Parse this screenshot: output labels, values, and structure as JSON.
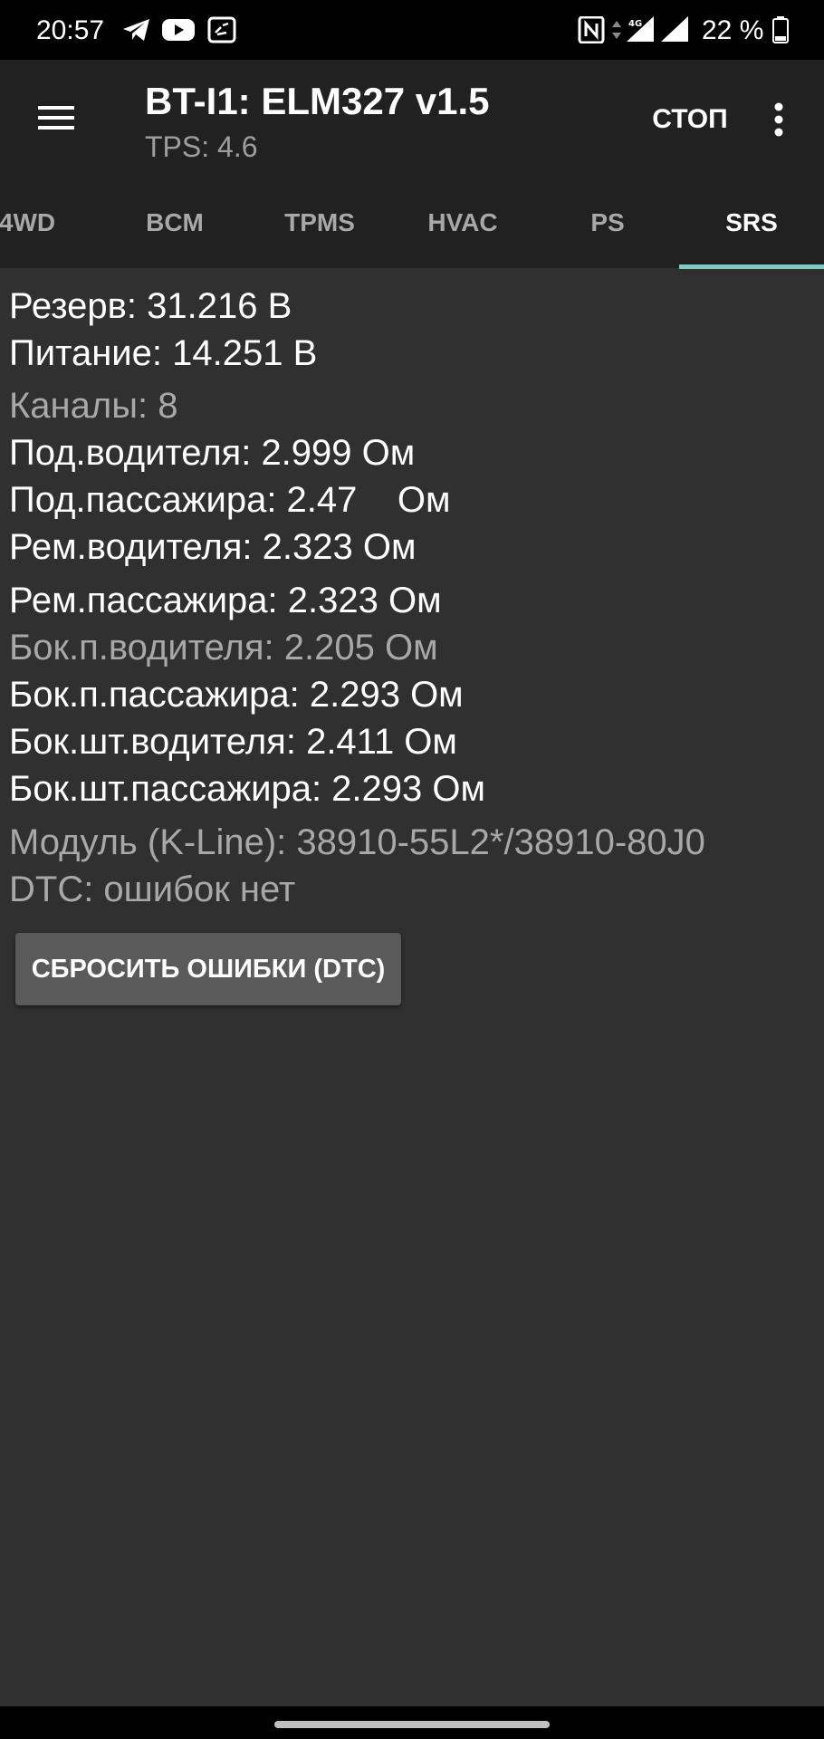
{
  "status_bar": {
    "time": "20:57",
    "battery": "22 %",
    "network": "4G",
    "icons": [
      "telegram-icon",
      "youtube-icon",
      "screenshot-icon",
      "nfc-icon",
      "data-arrows-icon",
      "signal-icon",
      "signal-icon",
      "battery-icon"
    ]
  },
  "app_bar": {
    "title": "BT-I1: ELM327 v1.5",
    "subtitle": "TPS: 4.6",
    "stop_label": "СТОП",
    "menu_icon": "menu-icon",
    "more_icon": "more-vert-icon"
  },
  "tabs": [
    {
      "label": "4WD",
      "active": false
    },
    {
      "label": "BCM",
      "active": false
    },
    {
      "label": "TPMS",
      "active": false
    },
    {
      "label": "HVAC",
      "active": false
    },
    {
      "label": "PS",
      "active": false
    },
    {
      "label": "SRS",
      "active": true
    }
  ],
  "rows": [
    "Резерв: 31.216 В",
    "Питание: 14.251 В",
    "Каналы: 8",
    "Под.водителя: 2.999 Ом",
    "Под.пассажира: 2.47    Ом",
    "Рем.водителя: 2.323 Ом",
    "Рем.пассажира: 2.323 Ом",
    "Бок.п.водителя: 2.205 Ом",
    "Бок.п.пассажира: 2.293 Ом",
    "Бок.шт.водителя: 2.411 Ом",
    "Бок.шт.пассажира: 2.293 Ом",
    "Модуль (K-Line): 38910-55L2*/38910-80J0",
    "DTC: ошибок нет"
  ],
  "reset_button": "СБРОСИТЬ ОШИБКИ (DTC)",
  "colors": {
    "background": "#303030",
    "app_bar": "#212121",
    "tab_indicator": "#80cbc4",
    "dim_text": "#a8a8a8",
    "button": "#5a5a5a"
  }
}
